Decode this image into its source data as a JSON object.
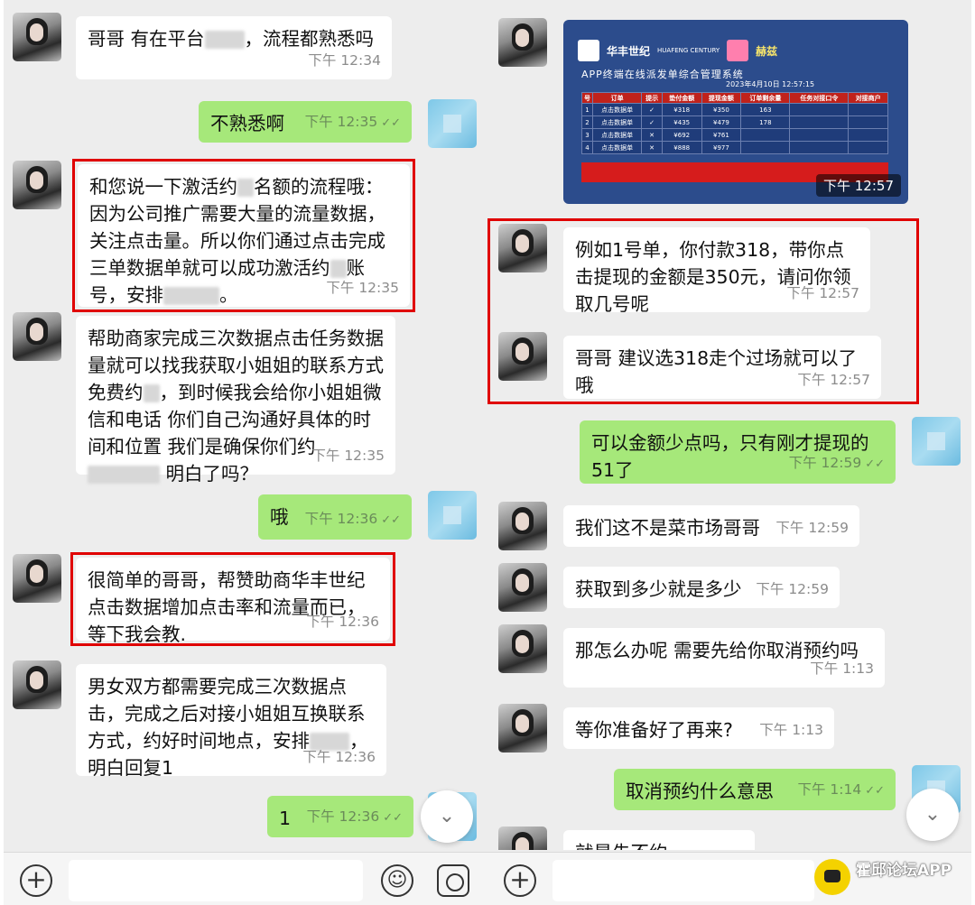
{
  "left": {
    "messages": [
      {
        "text_a": "哥哥 有在平台",
        "text_b": "，流程都熟悉吗",
        "time": "下午 12:34"
      },
      {
        "text": "不熟悉啊",
        "time": "下午 12:35"
      },
      {
        "text_a": "和您说一下激活约",
        "text_b": "名额的流程哦：因为公司推广需要大量的流量数据，关注点击量。所以你们通过点击完成三单数据单就可以成功激活约",
        "text_c": "账号，安排",
        "text_d": "。",
        "time": "下午 12:35"
      },
      {
        "text_a": "帮助商家完成三次数据点击任务数据量就可以找我获取小姐姐的联系方式免费约",
        "text_b": "，到时候我会给你小姐姐微信和电话 你们自己沟通好具体的时间和位置 我们是确保你们约",
        "text_c": "明白了吗？",
        "time": "下午 12:35"
      },
      {
        "text": "哦",
        "time": "下午 12:36"
      },
      {
        "text": "很简单的哥哥，帮赞助商华丰世纪点击数据增加点击率和流量而已，等下我会教.",
        "time": "下午 12:36"
      },
      {
        "text_a": "男女双方都需要完成三次数据点击，完成之后对接小姐姐互换联系方式，约好时间地点，安排",
        "text_b": "，明白回复1",
        "time": "下午 12:36"
      },
      {
        "text": "1",
        "time": "下午 12:36"
      }
    ]
  },
  "right": {
    "image": {
      "brand": "华丰世纪",
      "brand_en": "HUAFENG CENTURY",
      "brand2": "赫兹",
      "subtitle": "APP终端在线派发单综合管理系统",
      "date": "2023年4月10日 12:57:15",
      "time": "下午 12:57",
      "headers": [
        "号",
        "订单",
        "提示",
        "垫付金额",
        "提现金额",
        "订单剩余量",
        "任务对接口令",
        "对接商户"
      ],
      "rows": [
        [
          "1",
          "点击数据单",
          "✓",
          "¥318",
          "¥350",
          "163"
        ],
        [
          "2",
          "点击数据单",
          "✓",
          "¥435",
          "¥479",
          "178"
        ],
        [
          "3",
          "点击数据单",
          "✕",
          "¥692",
          "¥761",
          ""
        ],
        [
          "4",
          "点击数据单",
          "✕",
          "¥888",
          "¥977",
          ""
        ]
      ]
    },
    "messages": [
      {
        "text": "例如1号单，你付款318，带你点击提现的金额是350元，请问你领取几号呢",
        "time": "下午 12:57"
      },
      {
        "text": "哥哥 建议选318走个过场就可以了哦",
        "time": "下午 12:57"
      },
      {
        "text": "可以金额少点吗，只有刚才提现的51了",
        "time": "下午 12:59"
      },
      {
        "text": "我们这不是菜市场哥哥",
        "time": "下午 12:59"
      },
      {
        "text": "获取到多少就是多少",
        "time": "下午 12:59"
      },
      {
        "text": "那怎么办呢 需要先给你取消预约吗",
        "time": "下午 1:13"
      },
      {
        "text": "等你准备好了再来?",
        "time": "下午 1:13"
      },
      {
        "text": "取消预约什么意思",
        "time": "下午 1:14"
      },
      {
        "text": "就是先不约"
      }
    ]
  },
  "watermark": {
    "text": "霍邱论坛APP"
  },
  "icons": {
    "tick": "✓✓",
    "chevron": "chevron-down-icon",
    "plus": "+",
    "emoji": "☺"
  }
}
